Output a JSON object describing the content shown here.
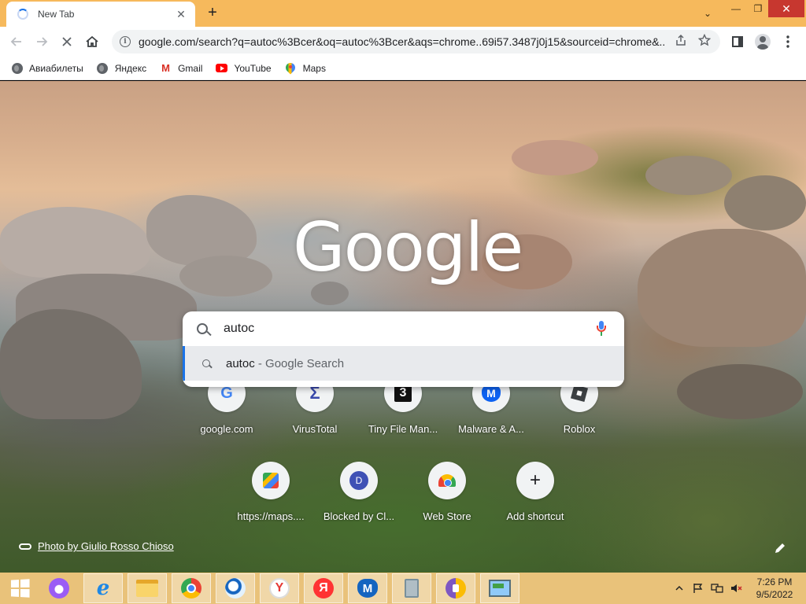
{
  "browser": {
    "tab": {
      "title": "New Tab",
      "close": "✕"
    },
    "new_tab_glyph": "+",
    "window_controls": {
      "dropdown": "⌄",
      "minimize": "—",
      "restore": "❐",
      "close": "✕"
    },
    "url": "google.com/search?q=autoc%3Bcer&oq=autoc%3Bcer&aqs=chrome..69i57.3487j0j15&sourceid=chrome&..."
  },
  "bookmarks": [
    {
      "label": "Авиабилеты",
      "icon": "globe-icon"
    },
    {
      "label": "Яндекс",
      "icon": "globe-icon"
    },
    {
      "label": "Gmail",
      "icon": "gmail-icon"
    },
    {
      "label": "YouTube",
      "icon": "youtube-icon"
    },
    {
      "label": "Maps",
      "icon": "maps-icon"
    }
  ],
  "ntp": {
    "logo_text": "Google",
    "search": {
      "value": "autoc"
    },
    "suggestion": {
      "query": "autoc",
      "separator": " - ",
      "source": "Google Search"
    },
    "shortcuts_row1": [
      {
        "label": "google.com",
        "icon": "google-g-icon",
        "glyph": "G"
      },
      {
        "label": "VirusTotal",
        "icon": "virustotal-icon",
        "glyph": "Σ"
      },
      {
        "label": "Tiny File Man...",
        "icon": "tiny-file-manager-icon",
        "glyph": "3"
      },
      {
        "label": "Malware & A...",
        "icon": "malwarebytes-icon",
        "glyph": "M"
      },
      {
        "label": "Roblox",
        "icon": "roblox-icon",
        "glyph": ""
      }
    ],
    "shortcuts_row2": [
      {
        "label": "https://maps....",
        "icon": "google-maps-icon",
        "glyph": ""
      },
      {
        "label": "Blocked by Cl...",
        "icon": "letter-d-icon",
        "glyph": "D"
      },
      {
        "label": "Web Store",
        "icon": "web-store-icon",
        "glyph": ""
      },
      {
        "label": "Add shortcut",
        "icon": "plus-icon",
        "glyph": "+"
      }
    ],
    "photo_credit": "Photo by Giulio Rosso Chioso"
  },
  "taskbar": {
    "apps": [
      {
        "name": "alice",
        "icon": "alice-icon",
        "active": false
      },
      {
        "name": "internet-explorer",
        "icon": "ie-icon",
        "glyph": "e",
        "active": true
      },
      {
        "name": "file-explorer",
        "icon": "folder-icon",
        "active": true
      },
      {
        "name": "chrome",
        "icon": "chrome-icon",
        "active": true
      },
      {
        "name": "ball-app",
        "icon": "ball-icon",
        "active": true
      },
      {
        "name": "yandex-browser",
        "icon": "yandex-browser-icon",
        "glyph": "Y",
        "active": true
      },
      {
        "name": "yandex",
        "icon": "yandex-icon",
        "glyph": "Я",
        "active": true
      },
      {
        "name": "malwarebytes",
        "icon": "malwarebytes-icon",
        "glyph": "M",
        "active": true
      },
      {
        "name": "usb-tool",
        "icon": "usb-icon",
        "active": true
      },
      {
        "name": "lock-app",
        "icon": "lock-icon",
        "active": true
      },
      {
        "name": "vm-app",
        "icon": "monitor-icon",
        "active": true
      }
    ],
    "time": "7:26 PM",
    "date": "9/5/2022"
  },
  "colors": {
    "accent": "#1a73e8",
    "titlebar": "#f6b95c",
    "taskbar": "#e9c27a",
    "close_red": "#c7372f"
  }
}
